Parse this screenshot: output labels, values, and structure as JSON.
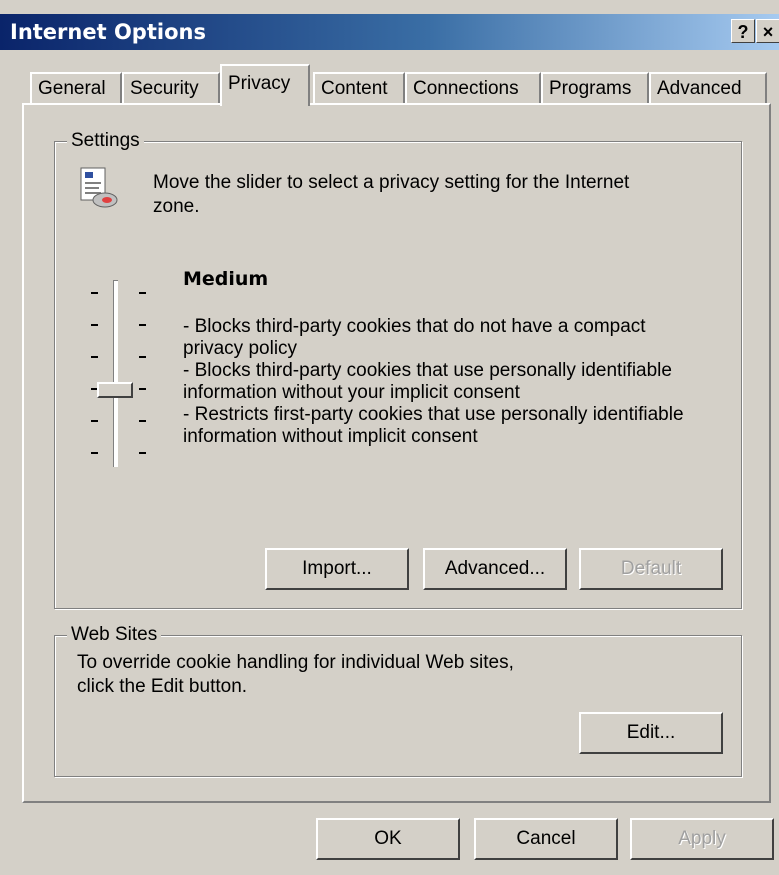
{
  "window": {
    "title": "Internet Options",
    "help_label": "?",
    "close_label": "×"
  },
  "tabs": [
    {
      "label": "General"
    },
    {
      "label": "Security"
    },
    {
      "label": "Privacy"
    },
    {
      "label": "Content"
    },
    {
      "label": "Connections"
    },
    {
      "label": "Programs"
    },
    {
      "label": "Advanced"
    }
  ],
  "active_tab": "Privacy",
  "settings": {
    "legend": "Settings",
    "icon": "privacy-settings-icon",
    "instruction_line1": "Move the slider to select a privacy setting for the Internet",
    "instruction_line2": "zone.",
    "level": "Medium",
    "description_lines": [
      "- Blocks third-party cookies that do not have a compact",
      "privacy policy",
      "- Blocks third-party cookies that use personally identifiable",
      "information without your implicit consent",
      "- Restricts first-party cookies that use personally identifiable",
      "information without implicit consent"
    ],
    "slider_levels": 6,
    "slider_selected_index": 3,
    "buttons": {
      "import": "Import...",
      "advanced": "Advanced...",
      "default": "Default"
    }
  },
  "web_sites": {
    "legend": "Web Sites",
    "line1": "To override cookie handling for individual Web sites,",
    "line2": "click the Edit button.",
    "edit_button": "Edit..."
  },
  "footer": {
    "ok": "OK",
    "cancel": "Cancel",
    "apply": "Apply"
  }
}
